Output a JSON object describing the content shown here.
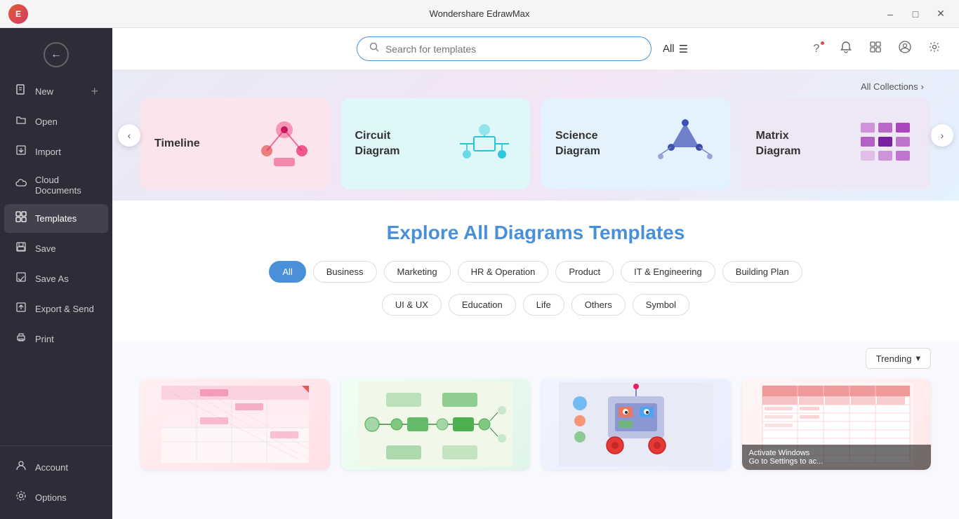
{
  "titleBar": {
    "appName": "Wondershare EdrawMax",
    "minBtn": "–",
    "maxBtn": "□",
    "closeBtn": "✕"
  },
  "topIcons": {
    "helpLabel": "?",
    "notificationLabel": "🔔",
    "userLabel": "👤",
    "appsLabel": "⊞",
    "settingsLabel": "⚙"
  },
  "search": {
    "placeholder": "Search for templates",
    "allLabel": "All"
  },
  "carousel": {
    "allCollectionsLabel": "All Collections",
    "prevBtn": "‹",
    "nextBtn": "›",
    "items": [
      {
        "label": "Timeline",
        "bg": "pink"
      },
      {
        "label": "Circuit\nDiagram",
        "bg": "teal"
      },
      {
        "label": "Science\nDiagram",
        "bg": "blue"
      },
      {
        "label": "Matrix\nDiagram",
        "bg": "purple"
      }
    ]
  },
  "explore": {
    "titlePrefix": "Explore",
    "titleHighlight": "All Diagrams Templates",
    "filters": [
      {
        "label": "All",
        "active": true
      },
      {
        "label": "Business",
        "active": false
      },
      {
        "label": "Marketing",
        "active": false
      },
      {
        "label": "HR & Operation",
        "active": false
      },
      {
        "label": "Product",
        "active": false
      },
      {
        "label": "IT & Engineering",
        "active": false
      },
      {
        "label": "Building Plan",
        "active": false
      },
      {
        "label": "UI & UX",
        "active": false
      },
      {
        "label": "Education",
        "active": false
      },
      {
        "label": "Life",
        "active": false
      },
      {
        "label": "Others",
        "active": false
      },
      {
        "label": "Symbol",
        "active": false
      }
    ]
  },
  "templatesToolbar": {
    "sortLabel": "Trending",
    "sortIcon": "▾"
  },
  "sidebar": {
    "newLabel": "New",
    "openLabel": "Open",
    "importLabel": "Import",
    "cloudLabel": "Cloud Documents",
    "templatesLabel": "Templates",
    "saveLabel": "Save",
    "saveAsLabel": "Save As",
    "exportLabel": "Export & Send",
    "printLabel": "Print",
    "accountLabel": "Account",
    "optionsLabel": "Options"
  },
  "activateWindows": {
    "line1": "Activate Windows",
    "line2": "Go to Settings to ac..."
  }
}
